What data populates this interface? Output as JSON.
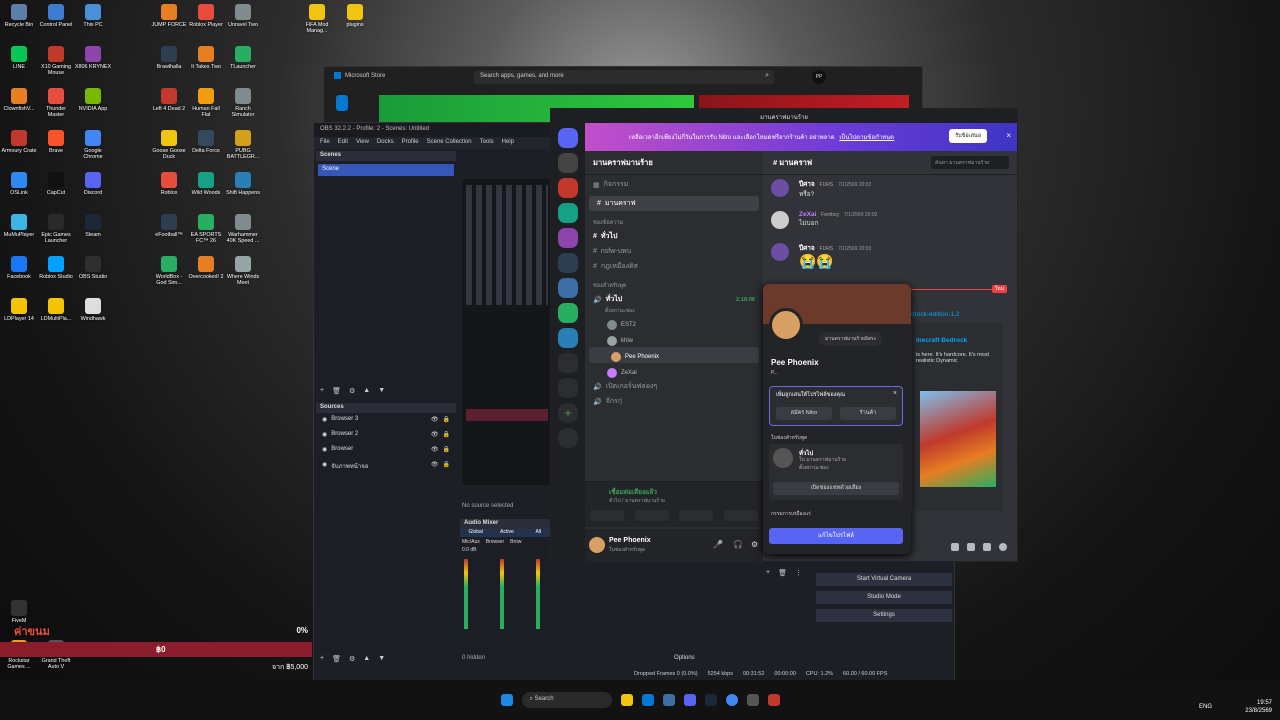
{
  "desktop_icons": [
    {
      "label": "Recycle Bin",
      "color": "#5b7fa8"
    },
    {
      "label": "Control Panel",
      "color": "#3f7bd0"
    },
    {
      "label": "This PC",
      "color": "#4a8fd8"
    },
    {
      "label": "LINE",
      "color": "#06c755"
    },
    {
      "label": "X10 Gaming Mouse",
      "color": "#c0392b"
    },
    {
      "label": "X806 KRYNEX",
      "color": "#8e44ad"
    },
    {
      "label": "ClownfishV...",
      "color": "#e67e22"
    },
    {
      "label": "Thunder Master",
      "color": "#e74c3c"
    },
    {
      "label": "NVIDIA App",
      "color": "#76b900"
    },
    {
      "label": "Armoury Crate",
      "color": "#c0392b"
    },
    {
      "label": "Brave",
      "color": "#fb542b"
    },
    {
      "label": "Google Chrome",
      "color": "#4285f4"
    },
    {
      "label": "OSLink",
      "color": "#2d89ef"
    },
    {
      "label": "CapCut",
      "color": "#111111"
    },
    {
      "label": "Discord",
      "color": "#5865f2"
    },
    {
      "label": "MuMuPlayer",
      "color": "#3ab5e6"
    },
    {
      "label": "Epic Games Launcher",
      "color": "#2a2a2a"
    },
    {
      "label": "Steam",
      "color": "#1b2838"
    },
    {
      "label": "Facebook",
      "color": "#1877f2"
    },
    {
      "label": "Roblox Studio",
      "color": "#00a2ff"
    },
    {
      "label": "OBS Studio",
      "color": "#302e31"
    },
    {
      "label": "LDPlayer 14",
      "color": "#f5c400"
    },
    {
      "label": "LDMultiPla...",
      "color": "#f5c400"
    },
    {
      "label": "Windhawk",
      "color": "#dddddd"
    }
  ],
  "desktop_icons_col2": [
    {
      "label": "JUMP FORCE",
      "color": "#e67e22"
    },
    {
      "label": "Roblox Player",
      "color": "#e74c3c"
    },
    {
      "label": "Unravel Two",
      "color": "#7f8c8d"
    },
    {
      "label": "Brawlhalla",
      "color": "#2c3e50"
    },
    {
      "label": "It Takes Two",
      "color": "#e67e22"
    },
    {
      "label": "TLauncher",
      "color": "#27ae60"
    },
    {
      "label": "Left 4 Dead 2",
      "color": "#c0392b"
    },
    {
      "label": "Human Fall Flat",
      "color": "#f39c12"
    },
    {
      "label": "Ranch Simulator",
      "color": "#7f8c8d"
    },
    {
      "label": "Goose Goose Duck",
      "color": "#f1c40f"
    },
    {
      "label": "Delta Force",
      "color": "#34495e"
    },
    {
      "label": "PUBG BATTLEGR...",
      "color": "#d4a017"
    },
    {
      "label": "Roblox",
      "color": "#e74c3c"
    },
    {
      "label": "Wild Woods",
      "color": "#16a085"
    },
    {
      "label": "Shift Happens",
      "color": "#2980b9"
    },
    {
      "label": "eFootball™",
      "color": "#2c3e50"
    },
    {
      "label": "EA SPORTS FC™ 26",
      "color": "#27ae60"
    },
    {
      "label": "Warhammer 40K Speed ...",
      "color": "#7f8c8d"
    },
    {
      "label": "WorldBox - God Sim...",
      "color": "#27ae60"
    },
    {
      "label": "Overcooked! 2",
      "color": "#e67e22"
    },
    {
      "label": "Where Winds Meet",
      "color": "#95a5a6"
    }
  ],
  "desktop_top": [
    {
      "label": "FiFA Mod Manag...",
      "color": "#f1c40f"
    },
    {
      "label": "plugins",
      "color": "#f1c40f"
    }
  ],
  "desktop_bottom": [
    {
      "label": "FiveM",
      "color": "#333333"
    },
    {
      "label": "Rockstar Games ...",
      "color": "#f39c12"
    },
    {
      "label": "Grand Theft Auto V",
      "color": "#555555"
    }
  ],
  "overlay": {
    "title": "ค่าขนม",
    "percent": "0%",
    "amount": "฿0",
    "goal": "จาก ฿5,000"
  },
  "store": {
    "title": "Microsoft Store",
    "search_placeholder": "Search apps, games, and more",
    "avatar": "PP"
  },
  "obs": {
    "title": "OBS 32.2.2 - Profile: 2 - Scenes: Untitled",
    "menu": [
      "File",
      "Edit",
      "View",
      "Docks",
      "Profile",
      "Scene Collection",
      "Tools",
      "Help"
    ],
    "scenes_label": "Scenes",
    "scene": "Scene",
    "sources_label": "Sources",
    "sources": [
      "Browser 3",
      "Browser 2",
      "Browser",
      "จับภาพหน้าจอ"
    ],
    "no_source": "No source selected",
    "mixer_label": "Audio Mixer",
    "mixer_tabs": [
      "Global",
      "Active",
      "All"
    ],
    "mixer_channels": [
      "Mic/Aux",
      "Browser",
      "Brow"
    ],
    "mixer_db": "0.0 dB",
    "hidden": "0 hidden",
    "options": "Options",
    "controls": [
      "Start Virtual Camera",
      "Studio Mode",
      "Settings"
    ],
    "status": {
      "dropped": "Dropped Frames 0 (0.0%)",
      "kbps": "5254 kbps",
      "rec": "00:31:52",
      "stream": "00:00:00",
      "cpu": "CPU: 1.2%",
      "fps": "60.00 / 60.00 FPS"
    }
  },
  "discord": {
    "title": "มานคราฟมานร้าย",
    "nitro_banner": "เหลือเวลาอีกเพียงไม่กี่วันในการรับ Nitro และเลือกโหมดฟรีจากร้านค้า อย่าพลาด",
    "nitro_link": "เป็นไปตามข้อกำหนด",
    "nitro_button": "รับข้อเสนอ",
    "server_name": "มานคราฟมานร้าย",
    "events": "กิจกรรม",
    "channels_top": "มานคราฟ",
    "text_cat": "ช่องข้อความ",
    "text_channels": [
      "ทั่วไป",
      "nsfw-บพบ",
      "กฎเหมืองดิส"
    ],
    "voice_cat": "ช่องสำหรับพูด",
    "voice_channel": "ทั่วไป",
    "voice_time": "2:18:06",
    "voice_sub": "ตั้งสถานะช่อง",
    "voice_users": [
      "EST2",
      "khiw",
      "Pee Phoenix",
      "ZeXai"
    ],
    "voice_others": [
      "เปิดเกอร์นฟลองๆ",
      "จักรกุ่"
    ],
    "connected": "เชื่อมต่อเสียงแล้ว",
    "connected_sub": "ทั่วไป / มานคราฟมานร้าย",
    "user_name": "Pee Phoenix",
    "user_status": "ในช่องสำหรับพูด",
    "chat_channel": "มานคราฟ",
    "chat_search": "ค้นหา มานคราฟมานร้าย",
    "messages": [
      {
        "user": "ปีศาจ",
        "tag": "FURS",
        "time": "7/1/2569 20:02",
        "text": "หรือ?"
      },
      {
        "user": "ZeXai",
        "tag": "Femboy",
        "time": "7/1/2569 20:02",
        "text": "ไม่บอก"
      },
      {
        "user": "ปีศาจ",
        "tag": "FURS",
        "time": "7/1/2569 20:03",
        "text": "😭😭"
      }
    ],
    "new_label": "ใหม่",
    "link_text": "drock-edition-1.2",
    "embed_title": "inecraft Bedrock",
    "embed_desc": "is here. It's hardcore. It's most realistic Dynamic",
    "popout": {
      "name": "Pee Phoenix",
      "sub": "P...",
      "status_note": "มานคราฟมานร้ายอิสระ",
      "card_title": "เพิ่มลูกเล่นให้โปรไฟล์ของคุณ",
      "nitro_btn": "สมัคร Nitro",
      "shop_btn": "ร้านค้า",
      "voice_title": "ในช่องสำหรับพูด",
      "voice_ch": "ทั่วไป",
      "voice_sub": "ใน มานคราฟมานร้าย",
      "voice_sub2": "ตั้งสถานะช่อง",
      "open_btn": "เปิดช่องแชทด้วยเสียง",
      "footer": "กรรมการเหมืองแร่",
      "edit_btn": "แก้ไขโปรไฟล์"
    }
  },
  "taskbar": {
    "search": "Search",
    "lang": "ENG",
    "time": "19:57",
    "date": "23/8/2569"
  }
}
